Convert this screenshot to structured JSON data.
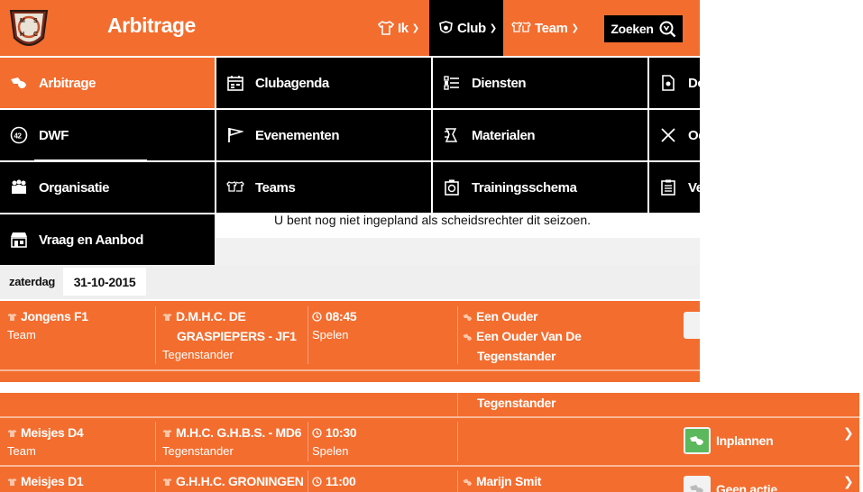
{
  "header": {
    "title": "Arbitrage",
    "nav": [
      {
        "label": "Ik"
      },
      {
        "label": "Club"
      },
      {
        "label": "Team"
      }
    ],
    "search_label": "Zoeken",
    "colors": {
      "accent": "#f36d2f",
      "dark": "#000000"
    }
  },
  "menu": {
    "items": [
      {
        "label": "Arbitrage",
        "icon": "whistle-icon",
        "active": true
      },
      {
        "label": "Clubagenda",
        "icon": "calendar-icon"
      },
      {
        "label": "Diensten",
        "icon": "list-icon"
      },
      {
        "label": "Do",
        "icon": "document-icon"
      },
      {
        "label": "DWF",
        "icon": "clock-badge-icon"
      },
      {
        "label": "Evenementen",
        "icon": "flag-icon"
      },
      {
        "label": "Materialen",
        "icon": "materials-icon"
      },
      {
        "label": "Oe",
        "icon": "crossed-sticks-icon"
      },
      {
        "label": "Organisatie",
        "icon": "people-icon"
      },
      {
        "label": "Teams",
        "icon": "shirt-icon"
      },
      {
        "label": "Trainingsschema",
        "icon": "stopwatch-icon"
      },
      {
        "label": "Ve",
        "icon": "clipboard-icon"
      },
      {
        "label": "Vraag en Aanbod",
        "icon": "shop-icon"
      }
    ]
  },
  "notice": "U bent nog niet ingepland als scheidsrechter dit seizoen.",
  "day": {
    "label": "zaterdag",
    "date": "31-10-2015"
  },
  "matches": [
    {
      "team": "Jongens F1",
      "team_sub": "Team",
      "opponent_line1": "D.M.H.C. DE",
      "opponent_line2": "GRASPIEPERS - JF1",
      "opponent_sub": "Tegenstander",
      "time": "08:45",
      "time_sub": "Spelen",
      "referee1": "Een Ouder",
      "referee2": "Een Ouder Van De",
      "referee2_line2": "Tegenstander"
    },
    {
      "referee_tail": "Tegenstander"
    },
    {
      "team": "Meisjes D4",
      "team_sub": "Team",
      "opponent_line1": "M.H.C. G.H.B.S. - MD6",
      "opponent_sub": "Tegenstander",
      "time": "10:30",
      "time_sub": "Spelen",
      "action": "Inplannen"
    },
    {
      "team": "Meisjes D1",
      "opponent_line1": "G.H.H.C. GRONINGEN -",
      "time": "11:00",
      "referee1": "Marijn Smit",
      "action": "Geen actie"
    }
  ]
}
